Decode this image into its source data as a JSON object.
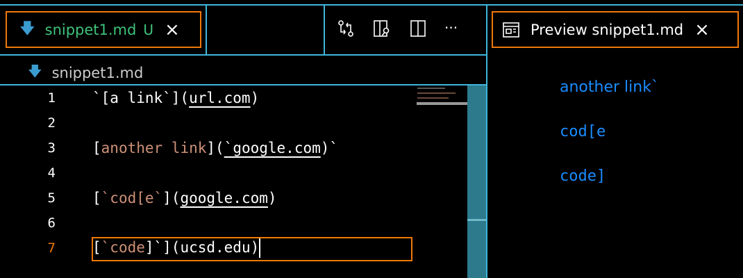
{
  "editor_tab": {
    "filename": "snippet1.md",
    "status": "U",
    "close": "×"
  },
  "breadcrumb": {
    "filename": "snippet1.md"
  },
  "toolbar": {
    "more": "···"
  },
  "preview_tab": {
    "title": "Preview snippet1.md",
    "close": "×"
  },
  "lines": [
    {
      "n": "1",
      "parts": [
        {
          "t": "`[a link`](",
          "c": ""
        },
        {
          "t": "url.com",
          "c": "u"
        },
        {
          "t": ")",
          "c": ""
        }
      ]
    },
    {
      "n": "2",
      "parts": []
    },
    {
      "n": "3",
      "parts": [
        {
          "t": "[",
          "c": ""
        },
        {
          "t": "another link",
          "c": "s"
        },
        {
          "t": "](",
          "c": ""
        },
        {
          "t": "`google.com",
          "c": "u"
        },
        {
          "t": ")`",
          "c": ""
        }
      ]
    },
    {
      "n": "4",
      "parts": []
    },
    {
      "n": "5",
      "parts": [
        {
          "t": "[",
          "c": ""
        },
        {
          "t": "`cod[e`",
          "c": "s"
        },
        {
          "t": "](",
          "c": ""
        },
        {
          "t": "google.com",
          "c": "u"
        },
        {
          "t": ")",
          "c": ""
        }
      ]
    },
    {
      "n": "6",
      "parts": []
    },
    {
      "n": "7",
      "parts": [
        {
          "t": "[",
          "c": ""
        },
        {
          "t": "`code",
          "c": "s"
        },
        {
          "t": "]`](ucsd.edu)",
          "c": ""
        }
      ]
    }
  ],
  "active_line": "7",
  "preview": {
    "items": [
      "another link`",
      "cod[e",
      "code]"
    ]
  },
  "colors": {
    "accent_border": "#3fb6dc",
    "focus": "#f0780a",
    "link": "#1a8cff",
    "string": "#ce9178",
    "untracked": "#3ec27a"
  }
}
